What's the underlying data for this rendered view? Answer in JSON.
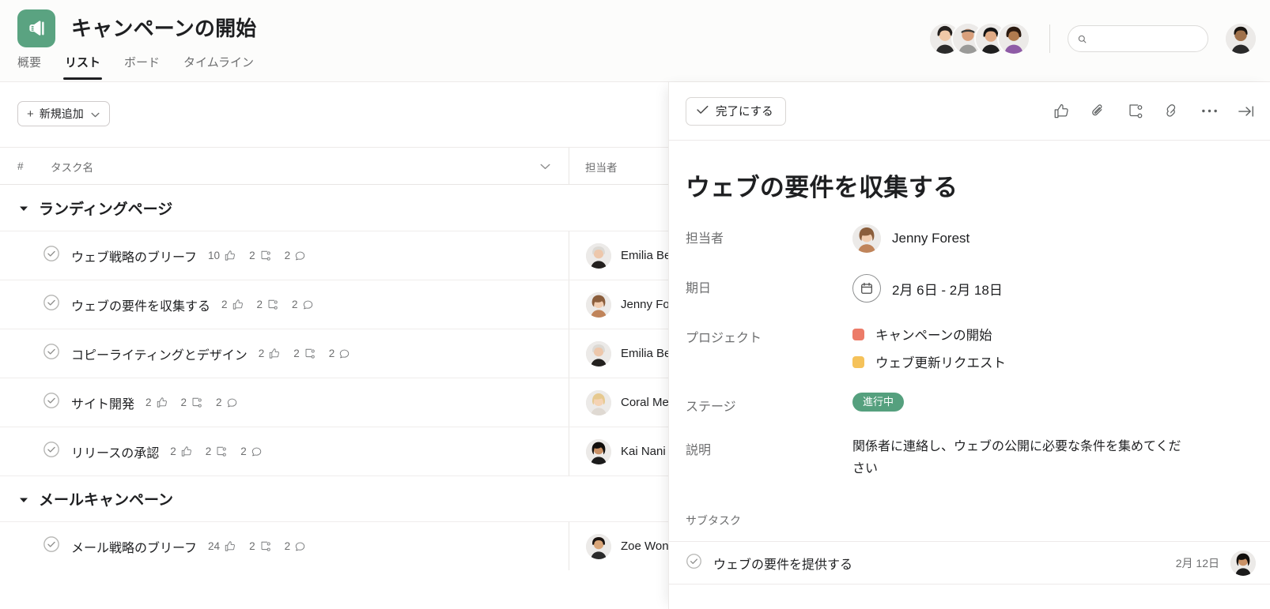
{
  "header": {
    "logo_icon": "megaphone-icon",
    "logo_color": "#5aa381",
    "project_title": "キャンペーンの開始",
    "tabs": [
      {
        "label": "概要",
        "active": false
      },
      {
        "label": "リスト",
        "active": true
      },
      {
        "label": "ボード",
        "active": false
      },
      {
        "label": "タイムライン",
        "active": false
      }
    ],
    "search": {
      "value": "",
      "placeholder": "",
      "icon": "search-icon"
    },
    "member_avatars": 4
  },
  "toolbar": {
    "add_label": "新規追加",
    "add_plus": "+",
    "add_chevron": "chevron-down-icon"
  },
  "table": {
    "columns": {
      "number": "#",
      "task_name": "タスク名",
      "assignee": "担当者"
    },
    "sort_icon": "chevron-down-icon"
  },
  "sections": [
    {
      "title": "ランディングページ",
      "collapsed": false,
      "tasks": [
        {
          "name": "ウェブ戦略のブリーフ",
          "likes": "10",
          "subtasks": "2",
          "comments": "2",
          "assignee": "Emilia Be",
          "avatar": "f1"
        },
        {
          "name": "ウェブの要件を収集する",
          "likes": "2",
          "subtasks": "2",
          "comments": "2",
          "assignee": "Jenny Fo",
          "avatar": "f2"
        },
        {
          "name": "コピーライティングとデザイン",
          "likes": "2",
          "subtasks": "2",
          "comments": "2",
          "assignee": "Emilia Be",
          "avatar": "f1"
        },
        {
          "name": "サイト開発",
          "likes": "2",
          "subtasks": "2",
          "comments": "2",
          "assignee": "Coral Me",
          "avatar": "f3"
        },
        {
          "name": "リリースの承認",
          "likes": "2",
          "subtasks": "2",
          "comments": "2",
          "assignee": "Kai Nani",
          "avatar": "f4"
        }
      ]
    },
    {
      "title": "メールキャンペーン",
      "collapsed": false,
      "tasks": [
        {
          "name": "メール戦略のブリーフ",
          "likes": "24",
          "subtasks": "2",
          "comments": "2",
          "assignee": "Zoe Won",
          "avatar": "f5"
        }
      ]
    }
  ],
  "panel": {
    "complete_label": "完了にする",
    "complete_icon": "check-icon",
    "icons": [
      "thumbs-up-icon",
      "paperclip-icon",
      "subtask-icon",
      "link-icon",
      "more-horizontal-icon",
      "collapse-right-icon"
    ],
    "task_title": "ウェブの要件を収集する",
    "fields": {
      "assignee_label": "担当者",
      "assignee_name": "Jenny Forest",
      "due_label": "期日",
      "due_value": "2月 6日 -  2月 18日",
      "due_icon": "calendar-icon",
      "projects_label": "プロジェクト",
      "projects": [
        {
          "name": "キャンペーンの開始",
          "color": "#ec7b68"
        },
        {
          "name": "ウェブ更新リクエスト",
          "color": "#f5c25a"
        }
      ],
      "stage_label": "ステージ",
      "stage_value": "進行中",
      "stage_color": "#55a07e",
      "description_label": "説明",
      "description_value": "関係者に連絡し、ウェブの公開に必要な条件を集めてください"
    },
    "subtask_section_label": "サブタスク",
    "subtasks": [
      {
        "name": "ウェブの要件を提供する",
        "date": "2月 12日",
        "avatar": "f4"
      }
    ]
  }
}
